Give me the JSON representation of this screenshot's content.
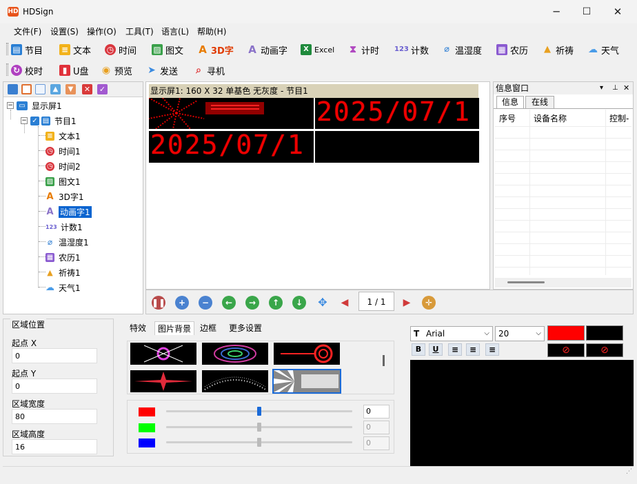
{
  "app": {
    "title": "HDSign",
    "logo_text": "HD"
  },
  "window_buttons": {
    "minimize": "─",
    "maximize": "☐",
    "close": "✕"
  },
  "menu": [
    "文件(F)",
    "设置(S)",
    "操作(O)",
    "工具(T)",
    "语言(L)",
    "帮助(H)"
  ],
  "toolbar1": [
    {
      "label": "节目",
      "icon": "program-icon",
      "color": "#2a7fd4"
    },
    {
      "label": "文本",
      "icon": "text-icon",
      "color": "#f2b21b"
    },
    {
      "label": "时间",
      "icon": "clock-icon",
      "color": "#d9363e"
    },
    {
      "label": "图文",
      "icon": "image-icon",
      "color": "#3aa04a"
    },
    {
      "label": "3D字",
      "icon": "3d-text-icon",
      "color": "#e87b00"
    },
    {
      "label": "动画字",
      "icon": "animated-text-icon",
      "color": "#8a72c8"
    },
    {
      "label": "Excel",
      "icon": "excel-icon",
      "color": "#1f8a3c"
    },
    {
      "label": "计时",
      "icon": "hourglass-icon",
      "color": "#b048c0"
    },
    {
      "label": "计数",
      "icon": "counter-icon",
      "color": "#6a5fd0",
      "glyph": "123"
    },
    {
      "label": "温湿度",
      "icon": "thermometer-icon",
      "color": "#4a8fd8"
    },
    {
      "label": "农历",
      "icon": "lunar-calendar-icon",
      "color": "#8a5ad0"
    },
    {
      "label": "祈祷",
      "icon": "prayer-icon",
      "color": "#e8a020"
    },
    {
      "label": "天气",
      "icon": "weather-icon",
      "color": "#4a9ce8"
    }
  ],
  "toolbar2": [
    {
      "label": "校时",
      "icon": "time-sync-icon",
      "color": "#b040c0"
    },
    {
      "label": "U盘",
      "icon": "usb-icon",
      "color": "#e0303a"
    },
    {
      "label": "预览",
      "icon": "eye-icon",
      "color": "#e8a020"
    },
    {
      "label": "发送",
      "icon": "send-icon",
      "color": "#3a8ae0"
    },
    {
      "label": "寻机",
      "icon": "search-icon",
      "color": "#e03a3a"
    }
  ],
  "tree": {
    "screen": "显示屏1",
    "program": "节目1",
    "items": [
      {
        "label": "文本1",
        "icon": "text-icon",
        "color": "#f2b21b"
      },
      {
        "label": "时间1",
        "icon": "clock-icon",
        "color": "#d9363e"
      },
      {
        "label": "时间2",
        "icon": "clock-icon",
        "color": "#d9363e"
      },
      {
        "label": "图文1",
        "icon": "image-icon",
        "color": "#3aa04a"
      },
      {
        "label": "3D字1",
        "icon": "3d-text-icon",
        "color": "#e87b00"
      },
      {
        "label": "动画字1",
        "icon": "animated-text-icon",
        "color": "#8a72c8",
        "selected": true
      },
      {
        "label": "计数1",
        "icon": "counter-icon",
        "color": "#6a5fd0"
      },
      {
        "label": "温湿度1",
        "icon": "thermometer-icon",
        "color": "#4a8fd8"
      },
      {
        "label": "农历1",
        "icon": "lunar-calendar-icon",
        "color": "#8a5ad0"
      },
      {
        "label": "祈祷1",
        "icon": "prayer-icon",
        "color": "#e8a020"
      },
      {
        "label": "天气1",
        "icon": "weather-icon",
        "color": "#4a9ce8"
      }
    ]
  },
  "preview": {
    "header": "显示屏1: 160 X 32  单基色  无灰度 - 节目1",
    "led_text": "2025/07/1",
    "led_color": "#e00000"
  },
  "info": {
    "title": "信息窗口",
    "tabs": [
      "信息",
      "在线"
    ],
    "columns": [
      "序号",
      "设备名称",
      "控制-"
    ],
    "pin": "⊥",
    "close": "✕",
    "menu": "▾"
  },
  "controls": {
    "page": "1 / 1"
  },
  "region": {
    "title": "区域位置",
    "start_x_label": "起点 X",
    "start_x": "0",
    "start_y_label": "起点 Y",
    "start_y": "0",
    "width_label": "区域宽度",
    "width": "80",
    "height_label": "区域高度",
    "height": "16"
  },
  "effects_tabs": [
    "特效",
    "图片背景",
    "边框",
    "更多设置"
  ],
  "colors": {
    "red": {
      "value": "0",
      "swatch": "#ff0000",
      "level": 0.5
    },
    "green": {
      "value": "0",
      "swatch": "#00ff00",
      "level": 0.5
    },
    "blue": {
      "value": "0",
      "swatch": "#0000ff",
      "level": 0.5
    }
  },
  "font": {
    "family": "Arial",
    "size": "20",
    "fg": "#ff0000",
    "bg": "#000000"
  }
}
